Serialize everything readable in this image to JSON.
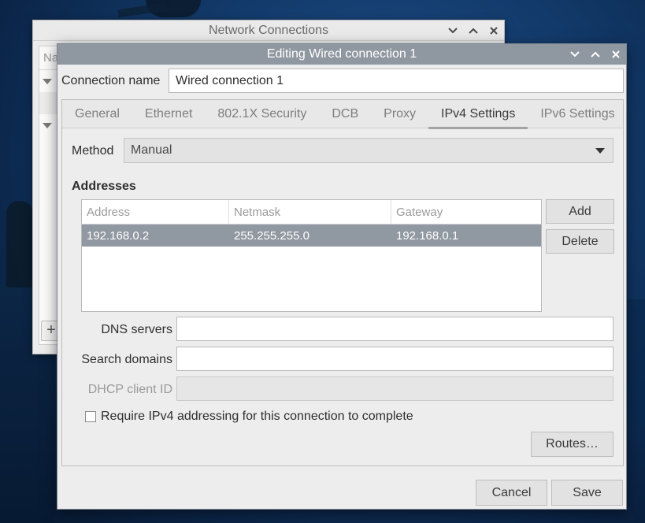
{
  "back_window": {
    "title": "Network Connections",
    "list_header": "Na"
  },
  "dialog": {
    "title": "Editing Wired connection 1",
    "connection_name_label": "Connection name",
    "connection_name_value": "Wired connection 1",
    "tabs": [
      {
        "label": "General"
      },
      {
        "label": "Ethernet"
      },
      {
        "label": "802.1X Security"
      },
      {
        "label": "DCB"
      },
      {
        "label": "Proxy"
      },
      {
        "label": "IPv4 Settings",
        "active": true
      },
      {
        "label": "IPv6 Settings"
      }
    ],
    "ipv4": {
      "method_label": "Method",
      "method_value": "Manual",
      "addresses_heading": "Addresses",
      "columns": [
        "Address",
        "Netmask",
        "Gateway"
      ],
      "rows": [
        {
          "address": "192.168.0.2",
          "netmask": "255.255.255.0",
          "gateway": "192.168.0.1",
          "selected": true
        }
      ],
      "add_label": "Add",
      "delete_label": "Delete",
      "dns_label": "DNS servers",
      "dns_value": "",
      "search_label": "Search domains",
      "search_value": "",
      "dhcp_label": "DHCP client ID",
      "dhcp_value": "",
      "require_label": "Require IPv4 addressing for this connection to complete",
      "require_checked": false,
      "routes_label": "Routes…"
    },
    "cancel_label": "Cancel",
    "save_label": "Save"
  },
  "icons": {
    "minimize": "chevron-down-icon",
    "maximize": "chevron-up-icon",
    "close": "close-icon"
  }
}
